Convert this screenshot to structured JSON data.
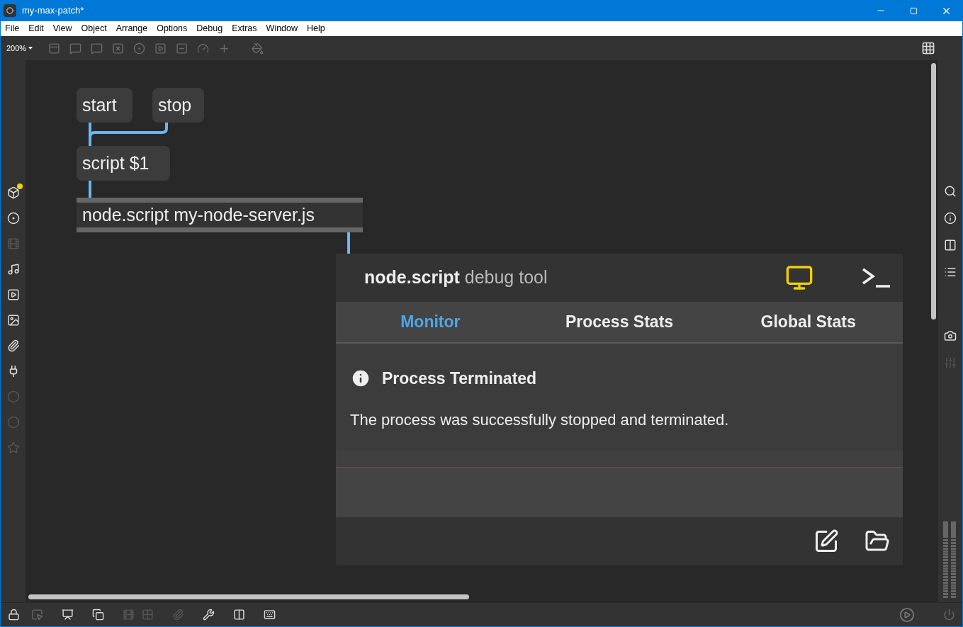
{
  "window": {
    "title": "my-max-patch*"
  },
  "menu": [
    "File",
    "Edit",
    "View",
    "Object",
    "Arrange",
    "Options",
    "Debug",
    "Extras",
    "Window",
    "Help"
  ],
  "toolbar": {
    "zoom": "200%"
  },
  "patch": {
    "messages": [
      {
        "text": "start"
      },
      {
        "text": "stop"
      },
      {
        "text": "script $1"
      }
    ],
    "object": {
      "text": "node.script my-node-server.js"
    },
    "debug_tool": {
      "title": "node.script",
      "subtitle": "debug tool",
      "tabs": [
        {
          "label": "Monitor",
          "selected": true
        },
        {
          "label": "Process Stats",
          "selected": false
        },
        {
          "label": "Global Stats",
          "selected": false
        }
      ],
      "notice": {
        "title": "Process Terminated",
        "message": "The process was successfully stopped and terminated."
      }
    }
  }
}
